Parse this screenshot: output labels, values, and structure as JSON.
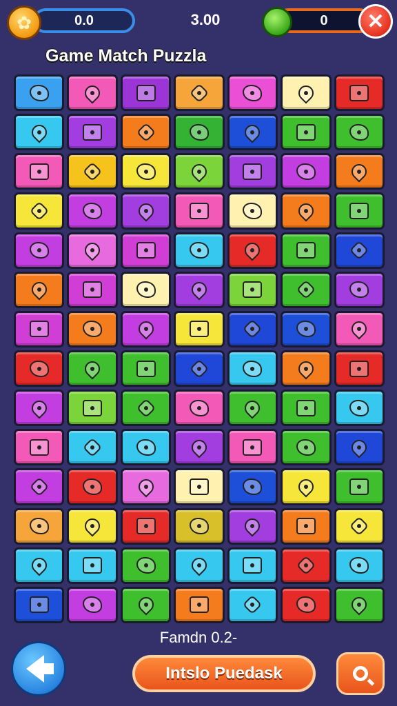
{
  "header": {
    "coin_value": "0.0",
    "center_value": "3.00",
    "gem_value": "0",
    "close_icon": "close-icon",
    "coin_icon": "coin-icon",
    "gem_icon": "gem-icon"
  },
  "title": "Game Match Puzzla",
  "board": {
    "columns": 7,
    "rows": 14,
    "tiles": [
      [
        "#3aa0f0",
        "#f35ab8",
        "#9b35d8",
        "#f6a53a",
        "#ea4fd6",
        "#fff2b0",
        "#e52a28"
      ],
      [
        "#37c8f0",
        "#a23ee0",
        "#f57c1c",
        "#34b234",
        "#1d4fd8",
        "#3fbf2e",
        "#3fbf2e"
      ],
      [
        "#f35ab8",
        "#f6c21c",
        "#f7e63a",
        "#7bd43a",
        "#a23ee0",
        "#c33ee0",
        "#f57c1c"
      ],
      [
        "#f7e63a",
        "#c33ee0",
        "#a23ee0",
        "#f35ab8",
        "#fff2b0",
        "#f57c1c",
        "#3fbf2e"
      ],
      [
        "#c33ee0",
        "#e86adf",
        "#d13ed6",
        "#37c8f0",
        "#e52a28",
        "#3fbf2e",
        "#2048d8"
      ],
      [
        "#f57c1c",
        "#d13ed6",
        "#fff2b0",
        "#a23ee0",
        "#7bd43a",
        "#3fbf2e",
        "#a23ee0"
      ],
      [
        "#d13ed6",
        "#f57c1c",
        "#c33ee0",
        "#f7e63a",
        "#2048d8",
        "#1d4fd8",
        "#f35ab8"
      ],
      [
        "#e52a28",
        "#3fbf2e",
        "#3fbf2e",
        "#2048d8",
        "#37c8f0",
        "#f57c1c",
        "#e52a28"
      ],
      [
        "#c33ee0",
        "#7bd43a",
        "#3fbf2e",
        "#f35ab8",
        "#3fbf2e",
        "#3fbf2e",
        "#37c8f0"
      ],
      [
        "#f35ab8",
        "#37c8f0",
        "#37c8f0",
        "#a23ee0",
        "#f35ab8",
        "#3fbf2e",
        "#2048d8"
      ],
      [
        "#c33ee0",
        "#e52a28",
        "#e86adf",
        "#fff2b0",
        "#1d4fd8",
        "#f7e63a",
        "#3fbf2e"
      ],
      [
        "#f6a53a",
        "#f7e63a",
        "#e52a28",
        "#d8c02a",
        "#a23ee0",
        "#f57c1c",
        "#f7e63a"
      ],
      [
        "#37c8f0",
        "#37c8f0",
        "#3fbf2e",
        "#37c8f0",
        "#37c8f0",
        "#e52a28",
        "#37c8f0"
      ],
      [
        "#1d4fd8",
        "#c33ee0",
        "#3fbf2e",
        "#f57c1c",
        "#37c8f0",
        "#e52a28",
        "#3fbf2e"
      ]
    ],
    "icon_shapes": [
      "blob",
      "drop",
      "box",
      "star",
      "blob",
      "drop",
      "box"
    ]
  },
  "footer": {
    "status_label": "Famdn 0.2-",
    "action_button": "Intslo   Puedask",
    "back_icon": "back-arrow-icon",
    "search_icon": "search-icon"
  }
}
